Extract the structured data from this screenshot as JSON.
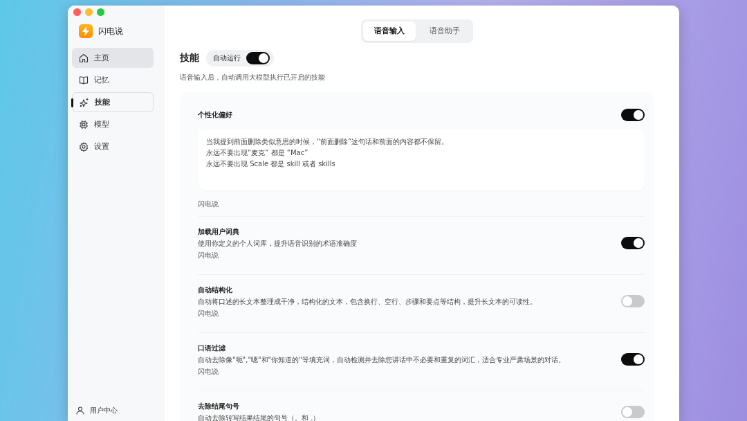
{
  "app": {
    "name": "闪电说"
  },
  "sidebar": {
    "items": [
      {
        "label": "主页",
        "selected": false,
        "hovered": true
      },
      {
        "label": "记忆",
        "selected": false,
        "hovered": false
      },
      {
        "label": "技能",
        "selected": true,
        "hovered": false
      },
      {
        "label": "模型",
        "selected": false,
        "hovered": false
      },
      {
        "label": "设置",
        "selected": false,
        "hovered": false
      }
    ],
    "footer": {
      "label": "用户中心"
    }
  },
  "tabs": [
    {
      "label": "语音输入",
      "selected": true
    },
    {
      "label": "语音助手",
      "selected": false
    }
  ],
  "section": {
    "title": "技能",
    "auto_run": {
      "label": "自动运行",
      "on": true
    },
    "subtitle": "语音输入后，自动调用大模型执行已开启的技能"
  },
  "skills": [
    {
      "kind": "prompt",
      "title": "个性化偏好",
      "on": true,
      "lines": [
        "当我提到前面删除类似意思的时候，“前面删除”这句话和前面的内容都不保留。",
        "永远不要出现“麦克” 都是 “Mac”",
        "永远不要出现 Scale 都是 skill 或者 skills"
      ],
      "source": "闪电说"
    },
    {
      "kind": "toggle",
      "title": "加载用户词典",
      "description": "使用你定义的个人词库，提升语音识别的术语准确度",
      "on": true,
      "source": "闪电说"
    },
    {
      "kind": "toggle",
      "title": "自动结构化",
      "description": "自动将口述的长文本整理成干净，结构化的文本，包含换行、空行、步骤和要点等结构，提升长文本的可读性。",
      "on": false,
      "source": "闪电说"
    },
    {
      "kind": "toggle",
      "title": "口语过滤",
      "description": "自动去除像\"呃\",\"嗯\"和\"你知道的\"等填充词，自动检测并去除您讲话中不必要和重复的词汇，适合专业严肃场景的对话。",
      "on": true,
      "source": "闪电说"
    },
    {
      "kind": "toggle",
      "title": "去除结尾句号",
      "description": "自动去除转写结果结尾的句号（。和 .）",
      "on": false
    }
  ]
}
